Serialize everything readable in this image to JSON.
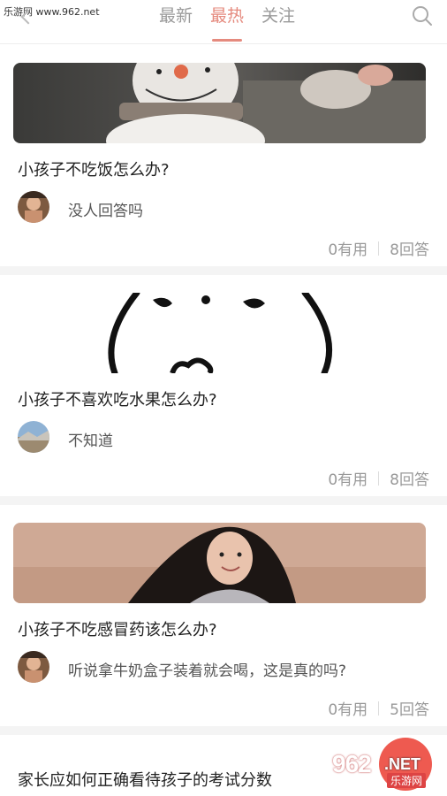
{
  "watermark_top": "乐游网 www.962.net",
  "tabs": [
    {
      "label": "最新",
      "active": false
    },
    {
      "label": "最热",
      "active": true
    },
    {
      "label": "关注",
      "active": false
    }
  ],
  "colors": {
    "accent": "#e58a7e",
    "fab": "#ee5a50"
  },
  "cards": [
    {
      "question": "小孩子不吃饭怎么办?",
      "answer": "没人回答吗",
      "useful": "0有用",
      "answers": "8回答",
      "image": "snowman-toy-photo",
      "avatar": "child-photo-avatar"
    },
    {
      "question": "小孩子不喜欢吃水果怎么办?",
      "answer": "不知道",
      "useful": "0有用",
      "answers": "8回答",
      "image": "cartoon-face-drawing",
      "avatar": "landscape-avatar"
    },
    {
      "question": "小孩子不吃感冒药该怎么办?",
      "answer": "听说拿牛奶盒子装着就会喝，这是真的吗?",
      "useful": "0有用",
      "answers": "5回答",
      "image": "girl-on-sand-photo",
      "avatar": "child-photo-avatar"
    }
  ],
  "last_question": "家长应如何正确看待孩子的考试分数",
  "watermark_bottom": {
    "logo": "962",
    "net": ".NET",
    "sub": "乐游网"
  }
}
